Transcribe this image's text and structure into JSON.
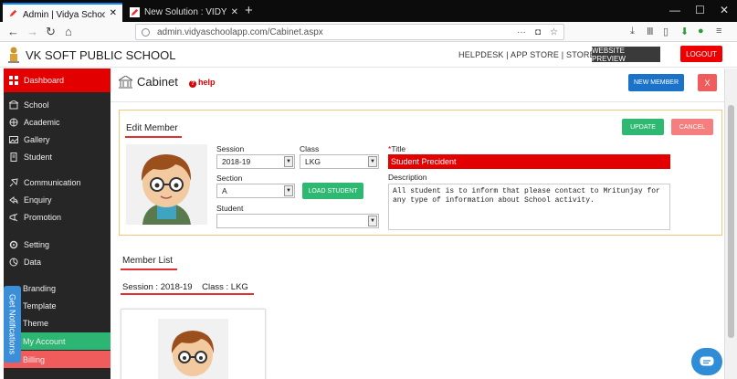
{
  "browser": {
    "tabs": [
      {
        "title": "Admin | Vidya School App | अ"
      },
      {
        "title": "New Solution : VIDYA SCHOO"
      }
    ],
    "url": "admin.vidyaschoolapp.com/Cabinet.aspx",
    "url_extra": "···"
  },
  "header": {
    "school_name": "VK SOFT PUBLIC SCHOOL",
    "links": "HELPDESK | APP STORE | STORE",
    "preview_label": "WEBSITE PREVIEW",
    "logout_label": "LOGOUT"
  },
  "sidebar": {
    "items": [
      {
        "label": "Dashboard",
        "icon": "dashboard-icon"
      },
      {
        "label": "School",
        "icon": "school-icon"
      },
      {
        "label": "Academic",
        "icon": "academic-icon"
      },
      {
        "label": "Gallery",
        "icon": "gallery-icon"
      },
      {
        "label": "Student",
        "icon": "student-icon"
      },
      {
        "label": "Communication",
        "icon": "communication-icon"
      },
      {
        "label": "Enquiry",
        "icon": "enquiry-icon"
      },
      {
        "label": "Promotion",
        "icon": "promotion-icon"
      },
      {
        "label": "Setting",
        "icon": "setting-icon"
      },
      {
        "label": "Data",
        "icon": "data-icon"
      },
      {
        "label": "Branding",
        "icon": "branding-icon"
      },
      {
        "label": "Template",
        "icon": "template-icon"
      },
      {
        "label": "Theme",
        "icon": "theme-icon"
      },
      {
        "label": "My Account",
        "icon": "account-icon"
      },
      {
        "label": "Billing",
        "icon": "billing-icon"
      }
    ],
    "notifications_label": "Get Notifications"
  },
  "page": {
    "title": "Cabinet",
    "help_label": "help",
    "new_member_label": "NEW MEMBER",
    "close_label": "X"
  },
  "edit": {
    "title": "Edit Member",
    "update_label": "UPDATE",
    "cancel_label": "CANCEL",
    "session_label": "Session",
    "session_value": "2018-19",
    "class_label": "Class",
    "class_value": "LKG",
    "section_label": "Section",
    "section_value": "A",
    "load_student_label": "LOAD STUDENT",
    "student_label": "Student",
    "student_value": "",
    "title_label_star": "*",
    "title_label": "Title",
    "title_value": "Student Precident",
    "description_label": "Description",
    "description_value": "All student is to inform that please contact to Mritunjay for any type of information about School activity."
  },
  "members": {
    "title": "Member List",
    "session_class": "Session : 2018-19    Class : LKG"
  },
  "colors": {
    "accent_red": "#e30000",
    "green": "#2eb872",
    "blue": "#1a73c9"
  }
}
